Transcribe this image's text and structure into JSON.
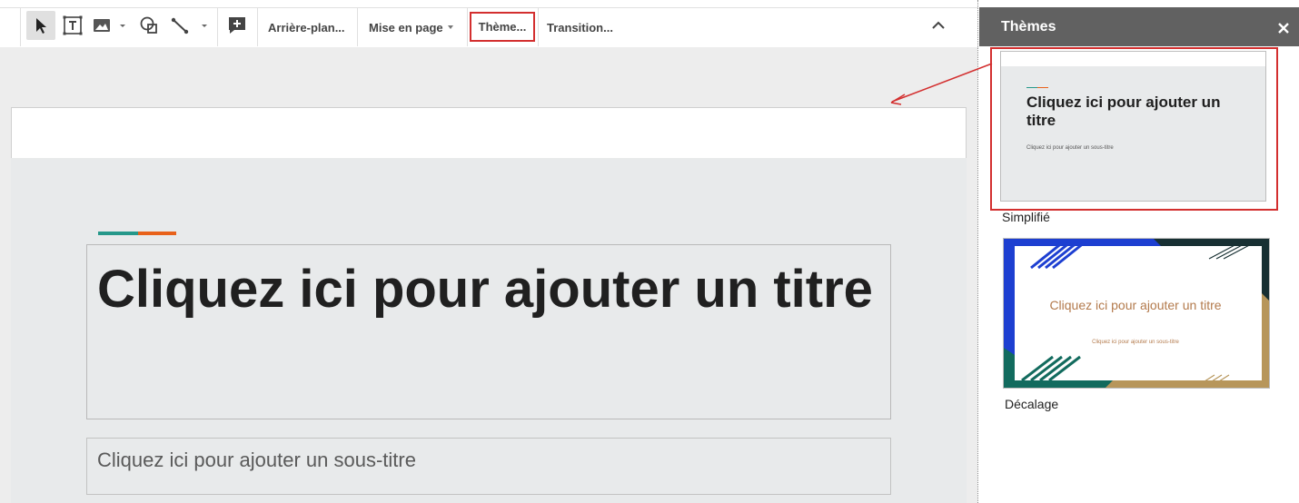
{
  "toolbar": {
    "tools": [
      {
        "name": "select-tool",
        "icon": "cursor-icon"
      },
      {
        "name": "text-box-tool",
        "icon": "text-box-icon"
      },
      {
        "name": "image-tool",
        "icon": "image-icon"
      },
      {
        "name": "shape-tool",
        "icon": "shape-icon"
      },
      {
        "name": "line-tool",
        "icon": "line-icon"
      },
      {
        "name": "new-comment-tool",
        "icon": "add-comment-icon"
      }
    ],
    "background_label": "Arrière-plan...",
    "layout_label": "Mise en page",
    "theme_label": "Thème...",
    "transition_label": "Transition..."
  },
  "slide": {
    "title": "Cliquez ici pour ajouter un titre",
    "subtitle": "Cliquez ici pour ajouter un sous-titre",
    "accent_colors": [
      "#26988a",
      "#e8611a"
    ]
  },
  "themes_panel": {
    "title": "Thèmes",
    "themes": [
      {
        "name": "Simplifié",
        "preview_title": "Cliquez ici pour ajouter un titre",
        "preview_subtitle": "Cliquez ici pour ajouter un sous-titre",
        "selected": true
      },
      {
        "name": "Décalage",
        "preview_title": "Cliquez ici pour ajouter un titre",
        "preview_subtitle": "Cliquez ici pour ajouter un sous-titre",
        "selected": false
      }
    ]
  },
  "colors": {
    "highlight": "#d32f2f",
    "panel_header": "#616161",
    "canvas": "#ededed"
  }
}
